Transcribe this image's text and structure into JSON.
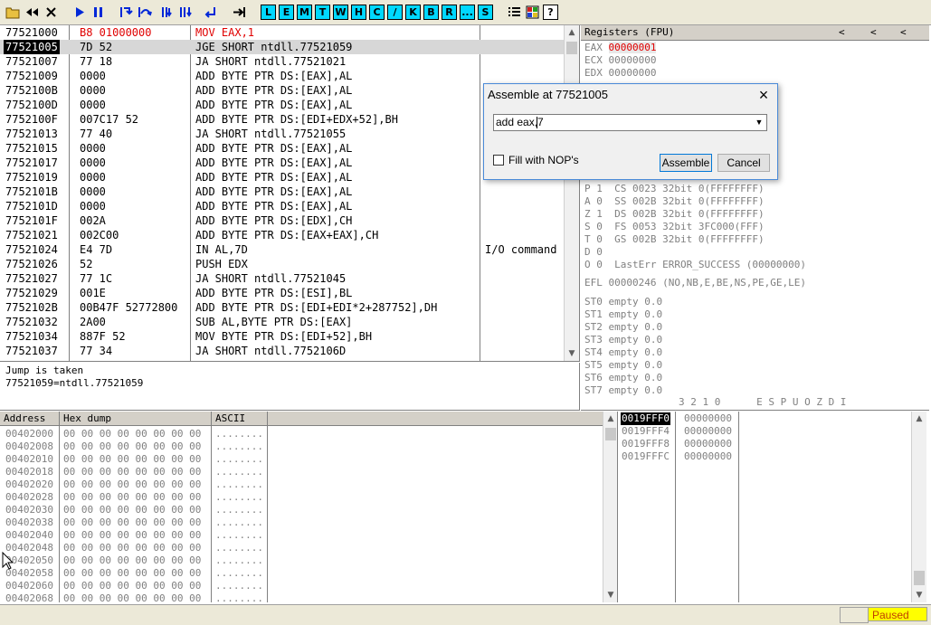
{
  "toolbar": {
    "open_icon": "folder-open-icon",
    "letters": [
      "L",
      "E",
      "M",
      "T",
      "W",
      "H",
      "C",
      "/",
      "K",
      "B",
      "R",
      "...",
      "S"
    ],
    "help": "?"
  },
  "disasm": {
    "rows": [
      {
        "addr": "77521000",
        "hex": "B8 01000000",
        "dis": "MOV EAX,1",
        "cmt": ""
      },
      {
        "addr": "77521005",
        "hex": "7D 52",
        "dis": "JGE SHORT ntdll.77521059",
        "cmt": ""
      },
      {
        "addr": "77521007",
        "hex": "77 18",
        "dis": "JA SHORT ntdll.77521021",
        "cmt": ""
      },
      {
        "addr": "77521009",
        "hex": "0000",
        "dis": "ADD BYTE PTR DS:[EAX],AL",
        "cmt": ""
      },
      {
        "addr": "7752100B",
        "hex": "0000",
        "dis": "ADD BYTE PTR DS:[EAX],AL",
        "cmt": ""
      },
      {
        "addr": "7752100D",
        "hex": "0000",
        "dis": "ADD BYTE PTR DS:[EAX],AL",
        "cmt": ""
      },
      {
        "addr": "7752100F",
        "hex": "007C17 52",
        "dis": "ADD BYTE PTR DS:[EDI+EDX+52],BH",
        "cmt": ""
      },
      {
        "addr": "77521013",
        "hex": "77 40",
        "dis": "JA SHORT ntdll.77521055",
        "cmt": ""
      },
      {
        "addr": "77521015",
        "hex": "0000",
        "dis": "ADD BYTE PTR DS:[EAX],AL",
        "cmt": ""
      },
      {
        "addr": "77521017",
        "hex": "0000",
        "dis": "ADD BYTE PTR DS:[EAX],AL",
        "cmt": ""
      },
      {
        "addr": "77521019",
        "hex": "0000",
        "dis": "ADD BYTE PTR DS:[EAX],AL",
        "cmt": ""
      },
      {
        "addr": "7752101B",
        "hex": "0000",
        "dis": "ADD BYTE PTR DS:[EAX],AL",
        "cmt": ""
      },
      {
        "addr": "7752101D",
        "hex": "0000",
        "dis": "ADD BYTE PTR DS:[EAX],AL",
        "cmt": ""
      },
      {
        "addr": "7752101F",
        "hex": "002A",
        "dis": "ADD BYTE PTR DS:[EDX],CH",
        "cmt": ""
      },
      {
        "addr": "77521021",
        "hex": "002C00",
        "dis": "ADD BYTE PTR DS:[EAX+EAX],CH",
        "cmt": ""
      },
      {
        "addr": "77521024",
        "hex": "E4 7D",
        "dis": "IN AL,7D",
        "cmt": "I/O command"
      },
      {
        "addr": "77521026",
        "hex": "52",
        "dis": "PUSH EDX",
        "cmt": ""
      },
      {
        "addr": "77521027",
        "hex": "77 1C",
        "dis": "JA SHORT ntdll.77521045",
        "cmt": ""
      },
      {
        "addr": "77521029",
        "hex": "001E",
        "dis": "ADD BYTE PTR DS:[ESI],BL",
        "cmt": ""
      },
      {
        "addr": "7752102B",
        "hex": "00B47F 52772800",
        "dis": "ADD BYTE PTR DS:[EDI+EDI*2+287752],DH",
        "cmt": ""
      },
      {
        "addr": "77521032",
        "hex": "2A00",
        "dis": "SUB AL,BYTE PTR DS:[EAX]",
        "cmt": ""
      },
      {
        "addr": "77521034",
        "hex": "887F 52",
        "dis": "MOV BYTE PTR DS:[EDI+52],BH",
        "cmt": ""
      },
      {
        "addr": "77521037",
        "hex": "77 34",
        "dis": "JA SHORT ntdll.7752106D",
        "cmt": ""
      }
    ]
  },
  "info": {
    "line1": "Jump is taken",
    "line2": "77521059=ntdll.77521059"
  },
  "registers": {
    "title": "Registers (FPU)",
    "nav": [
      "<",
      "<",
      "<"
    ],
    "top": [
      {
        "name": "EAX",
        "value": "00000001"
      },
      {
        "name": "ECX",
        "value": "00000000"
      },
      {
        "name": "EDX",
        "value": "00000000"
      }
    ],
    "flags": [
      "P 1  CS 0023 32bit 0(FFFFFFFF)",
      "A 0  SS 002B 32bit 0(FFFFFFFF)",
      "Z 1  DS 002B 32bit 0(FFFFFFFF)",
      "S 0  FS 0053 32bit 3FC000(FFF)",
      "T 0  GS 002B 32bit 0(FFFFFFFF)",
      "D 0",
      "O 0  LastErr ERROR_SUCCESS (00000000)"
    ],
    "efl": "EFL 00000246 (NO,NB,E,BE,NS,PE,GE,LE)",
    "st": [
      "ST0 empty 0.0",
      "ST1 empty 0.0",
      "ST2 empty 0.0",
      "ST3 empty 0.0",
      "ST4 empty 0.0",
      "ST5 empty 0.0",
      "ST6 empty 0.0",
      "ST7 empty 0.0"
    ],
    "footer": "3 2 1 0      E S P U O Z D I"
  },
  "dump": {
    "headers": [
      "Address",
      "Hex dump",
      "ASCII"
    ],
    "rows": [
      {
        "addr": "00402000",
        "hex": "00 00 00 00 00 00 00 00",
        "ascii": "........"
      },
      {
        "addr": "00402008",
        "hex": "00 00 00 00 00 00 00 00",
        "ascii": "........"
      },
      {
        "addr": "00402010",
        "hex": "00 00 00 00 00 00 00 00",
        "ascii": "........"
      },
      {
        "addr": "00402018",
        "hex": "00 00 00 00 00 00 00 00",
        "ascii": "........"
      },
      {
        "addr": "00402020",
        "hex": "00 00 00 00 00 00 00 00",
        "ascii": "........"
      },
      {
        "addr": "00402028",
        "hex": "00 00 00 00 00 00 00 00",
        "ascii": "........"
      },
      {
        "addr": "00402030",
        "hex": "00 00 00 00 00 00 00 00",
        "ascii": "........"
      },
      {
        "addr": "00402038",
        "hex": "00 00 00 00 00 00 00 00",
        "ascii": "........"
      },
      {
        "addr": "00402040",
        "hex": "00 00 00 00 00 00 00 00",
        "ascii": "........"
      },
      {
        "addr": "00402048",
        "hex": "00 00 00 00 00 00 00 00",
        "ascii": "........"
      },
      {
        "addr": "00402050",
        "hex": "00 00 00 00 00 00 00 00",
        "ascii": "........"
      },
      {
        "addr": "00402058",
        "hex": "00 00 00 00 00 00 00 00",
        "ascii": "........"
      },
      {
        "addr": "00402060",
        "hex": "00 00 00 00 00 00 00 00",
        "ascii": "........"
      },
      {
        "addr": "00402068",
        "hex": "00 00 00 00 00 00 00 00",
        "ascii": "........"
      }
    ]
  },
  "stack": {
    "rows": [
      {
        "addr": "0019FFF0",
        "value": "00000000"
      },
      {
        "addr": "0019FFF4",
        "value": "00000000"
      },
      {
        "addr": "0019FFF8",
        "value": "00000000"
      },
      {
        "addr": "0019FFFC",
        "value": "00000000"
      }
    ]
  },
  "dialog": {
    "title": "Assemble at 77521005",
    "close": "×",
    "input_value": "add eax,7",
    "checkbox_label": "Fill with NOP's",
    "assemble": "Assemble",
    "cancel": "Cancel"
  },
  "status": {
    "state": "Paused"
  },
  "colors": {
    "accent": "#00d8ff",
    "highlight": "#e00000",
    "status": "#ffff00"
  }
}
